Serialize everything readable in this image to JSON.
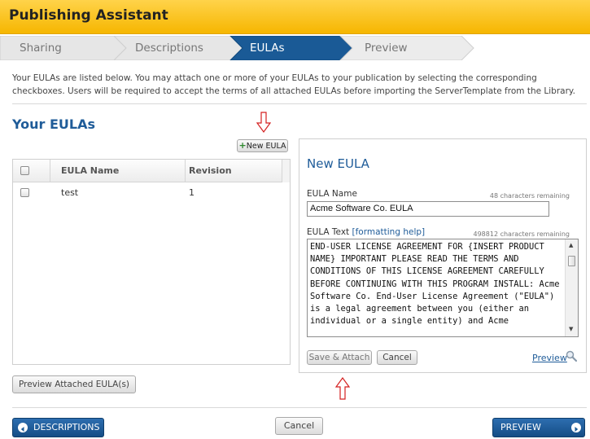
{
  "header": {
    "title": "Publishing Assistant"
  },
  "steps": [
    {
      "label": "Sharing",
      "state": "done"
    },
    {
      "label": "Descriptions",
      "state": "done"
    },
    {
      "label": "EULAs",
      "state": "active"
    },
    {
      "label": "Preview",
      "state": "todo"
    }
  ],
  "intro": "Your EULAs are listed below. You may attach one or more of your EULAs to your publication by selecting the corresponding checkboxes. Users will be required to accept the terms of all attached EULAs before importing the ServerTemplate from the Library.",
  "eulas": {
    "section_title": "Your EULAs",
    "new_eula_label": "New EULA",
    "columns": [
      "EULA Name",
      "Revision"
    ],
    "rows": [
      {
        "name": "test",
        "revision": "1",
        "checked": false
      }
    ],
    "preview_attached_label": "Preview Attached EULA(s)"
  },
  "new_eula": {
    "title": "New EULA",
    "name_label": "EULA Name",
    "name_remaining": "48 characters remaining",
    "name_value": "Acme Software Co. EULA",
    "text_label": "EULA Text",
    "formatting_help": "[formatting help]",
    "text_remaining": "498812 characters remaining",
    "text_value": "END-USER LICENSE AGREEMENT FOR {INSERT PRODUCT NAME} IMPORTANT PLEASE READ THE TERMS AND CONDITIONS OF THIS LICENSE AGREEMENT CAREFULLY BEFORE CONTINUING WITH THIS PROGRAM INSTALL: Acme Software Co. End-User License Agreement (\"EULA\") is a legal agreement between you (either an individual or a single entity) and Acme",
    "save_attach_label": "Save & Attach",
    "cancel_label": "Cancel",
    "preview_label": "Preview"
  },
  "footer": {
    "back_label": "DESCRIPTIONS",
    "cancel_label": "Cancel",
    "next_label": "PREVIEW"
  },
  "colors": {
    "header_yellow": "#f6b600",
    "step_active": "#1a5a96",
    "link_blue": "#1f5c99",
    "annotation_red": "#d42020"
  }
}
